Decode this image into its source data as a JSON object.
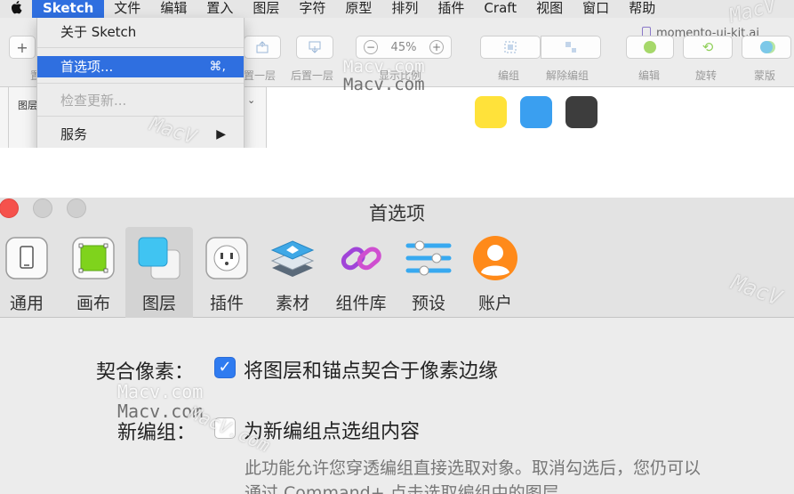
{
  "menubar": {
    "apple_icon": "apple-icon",
    "items": [
      "Sketch",
      "文件",
      "编辑",
      "置入",
      "图层",
      "字符",
      "原型",
      "排列",
      "插件",
      "Craft",
      "视图",
      "窗口",
      "帮助"
    ]
  },
  "document": {
    "title": "momento-ui-kit.ai"
  },
  "toolbar": {
    "labels": [
      "置一层",
      "后置一层",
      "显示比例",
      "编组",
      "解除编组",
      "编辑",
      "旋转",
      "蒙版"
    ],
    "zoom": {
      "value": "45%",
      "minus": "−",
      "plus": "+"
    },
    "truncated_label": "置"
  },
  "layers_panel": {
    "label": "图层"
  },
  "canvas": {
    "swatches": [
      "#ffe23a",
      "#3a9ff0",
      "#3d3d3d"
    ]
  },
  "sketch_menu": {
    "items": [
      {
        "label": "关于 Sketch",
        "shortcut": "",
        "state": "normal"
      },
      {
        "label": "首选项...",
        "shortcut": "⌘,",
        "state": "highlighted"
      },
      {
        "label": "检查更新...",
        "shortcut": "",
        "state": "disabled"
      },
      {
        "label": "服务",
        "shortcut": "▶",
        "state": "normal"
      }
    ]
  },
  "preferences": {
    "title": "首选项",
    "tabs": [
      {
        "label": "通用",
        "icon": "general-device-icon"
      },
      {
        "label": "画布",
        "icon": "canvas-square-icon"
      },
      {
        "label": "图层",
        "icon": "layers-stack-icon",
        "selected": true
      },
      {
        "label": "插件",
        "icon": "plugin-socket-icon"
      },
      {
        "label": "素材",
        "icon": "assets-stack-icon"
      },
      {
        "label": "组件库",
        "icon": "library-link-icon"
      },
      {
        "label": "预设",
        "icon": "presets-sliders-icon"
      },
      {
        "label": "账户",
        "icon": "account-avatar-icon"
      }
    ],
    "settings": [
      {
        "label": "契合像素：",
        "option": "将图层和锚点契合于像素边缘",
        "checked": true
      },
      {
        "label": "新编组：",
        "option": "为新编组点选组内容",
        "checked": false
      }
    ],
    "description": [
      "此功能允许您穿透编组直接选取对象。取消勾选后，您仍可以",
      "通过 Command+ 点击选取编组中的图层"
    ]
  },
  "watermarks": [
    "Macv.com",
    "Macv.com",
    "Macv.com",
    "Macv.com",
    "MacV",
    "MacV",
    "MacV.com",
    "MacV"
  ],
  "colors": {
    "accent": "#2f6fe0",
    "checkbox": "#2f7bf0",
    "close": "#f5524c",
    "inactive_light": "#cfcfcf"
  }
}
